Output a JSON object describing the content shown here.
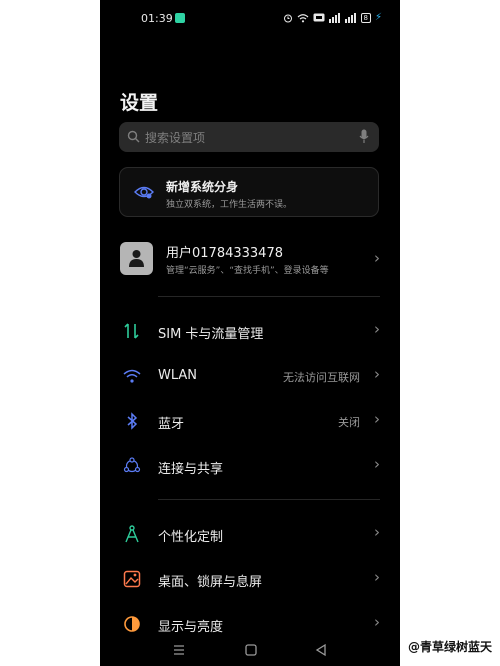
{
  "status_bar": {
    "time": "01:39",
    "battery": "8"
  },
  "title": "设置",
  "search": {
    "placeholder": "搜索设置项"
  },
  "promo": {
    "title": "新增系统分身",
    "subtitle": "独立双系统，工作生活两不误。"
  },
  "account": {
    "name": "用户01784333478",
    "subtitle": "管理“云服务”、“查找手机”、登录设备等"
  },
  "items": [
    {
      "label": "SIM 卡与流量管理",
      "value": "",
      "icon": "sim-data-icon",
      "color": "#2ecc9a"
    },
    {
      "label": "WLAN",
      "value": "无法访问互联网",
      "icon": "wifi-icon",
      "color": "#5b7cf5"
    },
    {
      "label": "蓝牙",
      "value": "关闭",
      "icon": "bluetooth-icon",
      "color": "#5b7cf5"
    },
    {
      "label": "连接与共享",
      "value": "",
      "icon": "share-icon",
      "color": "#5b7cf5"
    },
    {
      "label": "个性化定制",
      "value": "",
      "icon": "personalize-icon",
      "color": "#2ecc9a"
    },
    {
      "label": "桌面、锁屏与息屏",
      "value": "",
      "icon": "wallpaper-icon",
      "color": "#ff7a4d"
    },
    {
      "label": "显示与亮度",
      "value": "",
      "icon": "brightness-icon",
      "color": "#ff9a3c"
    }
  ],
  "watermark": "@青草绿树蓝天"
}
